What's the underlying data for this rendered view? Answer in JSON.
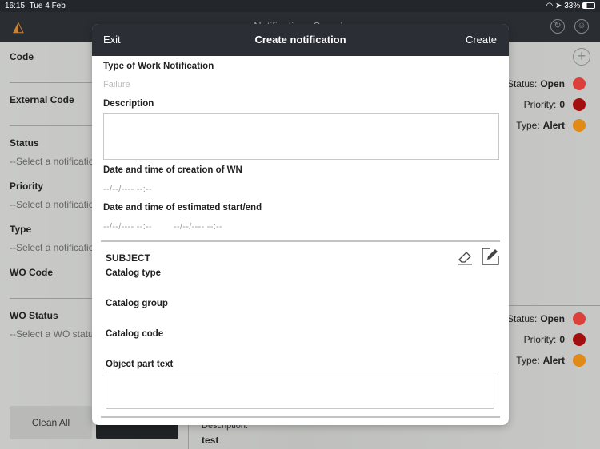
{
  "status_bar": {
    "time": "16:15",
    "date": "Tue 4 Feb",
    "battery": "33%"
  },
  "app": {
    "title": "Notifications Search"
  },
  "filters": [
    {
      "label": "Code"
    },
    {
      "label": "External Code"
    },
    {
      "label": "Status",
      "placeholder": "--Select a notification"
    },
    {
      "label": "Priority",
      "placeholder": "--Select a notification"
    },
    {
      "label": "Type",
      "placeholder": "--Select a notification"
    },
    {
      "label": "WO Code"
    },
    {
      "label": "WO Status",
      "placeholder": "--Select a WO status"
    }
  ],
  "buttons": {
    "clean_all": "Clean All"
  },
  "results": [
    {
      "status_label": "Status:",
      "status": "Open",
      "priority_label": "Priority:",
      "priority": "0",
      "type_label": "Type:",
      "type": "Alert"
    },
    {
      "status_label": "Status:",
      "status": "Open",
      "priority_label": "Priority:",
      "priority": "0",
      "type_label": "Type:",
      "type": "Alert"
    }
  ],
  "result_desc": {
    "label": "Description:",
    "value": "test"
  },
  "colors": {
    "status": "#d9413a",
    "priority": "#a30f0f",
    "type": "#e08a18"
  },
  "modal": {
    "exit": "Exit",
    "title": "Create notification",
    "create": "Create",
    "type_label": "Type of Work Notification",
    "type_placeholder": "Failure",
    "description_label": "Description",
    "creation_label": "Date and time of creation of WN",
    "creation_value": "--/--/---- --:--",
    "estimated_label": "Date and time of estimated start/end",
    "start_value": "--/--/---- --:--",
    "end_value": "--/--/---- --:--",
    "subject": "SUBJECT",
    "catalog_type": "Catalog type",
    "catalog_group": "Catalog group",
    "catalog_code": "Catalog code",
    "object_part_text": "Object part text"
  }
}
